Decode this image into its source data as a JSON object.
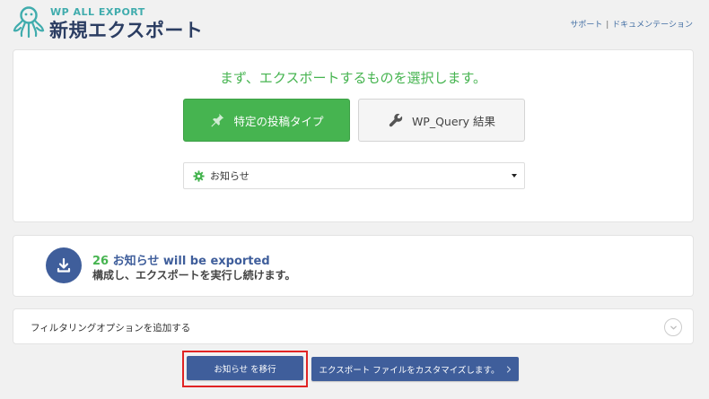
{
  "header": {
    "brand_small": "WP ALL EXPORT",
    "title": "新規エクスポート",
    "links": {
      "support": "サポート",
      "separator": "|",
      "docs": "ドキュメンテーション"
    }
  },
  "select_panel": {
    "heading": "まず、エクスポートするものを選択します。",
    "buttons": {
      "specific_post_type": "特定の投稿タイプ",
      "wp_query": "WP_Query 結果"
    },
    "post_type_select": {
      "selected": "お知らせ"
    }
  },
  "export_info": {
    "count": "26",
    "post_type": "お知らせ",
    "suffix": "will be exported",
    "description": "構成し、エクスポートを実行し続けます。"
  },
  "filter_panel": {
    "label": "フィルタリングオプションを追加する"
  },
  "footer_buttons": {
    "migrate": "お知らせ を移行",
    "customize": "エクスポート ファイルをカスタマイズします。"
  },
  "colors": {
    "accent_green": "#46b450",
    "primary_blue": "#3f5e9b",
    "title_navy": "#2b3d62",
    "highlight_red": "#e02424"
  }
}
